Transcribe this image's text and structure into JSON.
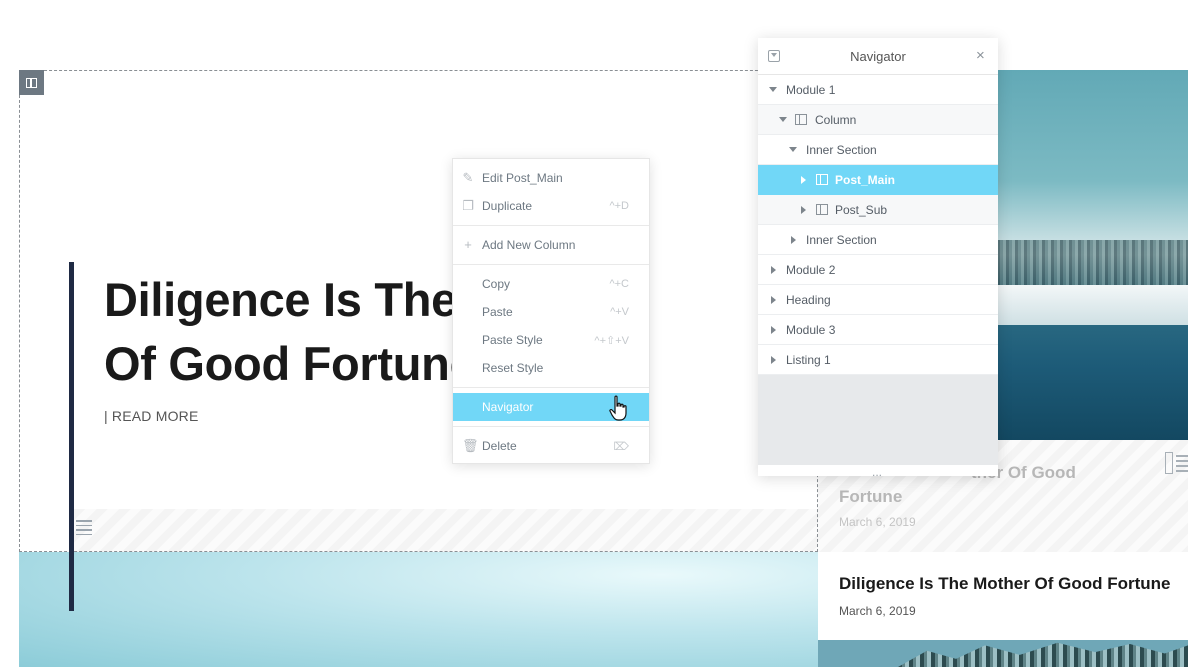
{
  "page": {
    "hero_title": "Diligence Is The\nOf Good Fortune",
    "read_more": "| READ MORE",
    "faded_post": {
      "title": "Dilige... ...ther Of Good Fortune",
      "title_line1_visible": "ther Of Good",
      "title_line2_visible": "Fortune",
      "date": "March 6, 2019"
    },
    "post_card": {
      "title": "Diligence Is The Mother Of Good Fortune",
      "date": "March 6, 2019"
    }
  },
  "context_menu": {
    "items": [
      {
        "label": "Edit Post_Main",
        "icon": "pencil-icon",
        "shortcut": ""
      },
      {
        "label": "Duplicate",
        "icon": "copy-icon",
        "shortcut": "^+D"
      },
      {
        "label": "Add New Column",
        "icon": "plus-icon",
        "shortcut": ""
      },
      {
        "label": "Copy",
        "icon": "",
        "shortcut": "^+C"
      },
      {
        "label": "Paste",
        "icon": "",
        "shortcut": "^+V"
      },
      {
        "label": "Paste Style",
        "icon": "",
        "shortcut": "^+⇧+V"
      },
      {
        "label": "Reset Style",
        "icon": "",
        "shortcut": ""
      },
      {
        "label": "Navigator",
        "icon": "",
        "shortcut": ""
      },
      {
        "label": "Delete",
        "icon": "trash-icon",
        "shortcut": "⌦"
      }
    ],
    "active_item": "Navigator"
  },
  "navigator": {
    "title": "Navigator",
    "close": "×",
    "resize_handle": "...",
    "rows": [
      {
        "label": "Module 1",
        "expanded": true,
        "has_icon": false
      },
      {
        "label": "Column",
        "expanded": true,
        "has_icon": true
      },
      {
        "label": "Inner Section",
        "expanded": true,
        "has_icon": false
      },
      {
        "label": "Post_Main",
        "expanded": false,
        "has_icon": true,
        "selected": true
      },
      {
        "label": "Post_Sub",
        "expanded": false,
        "has_icon": true
      },
      {
        "label": "Inner Section",
        "expanded": false,
        "has_icon": false
      },
      {
        "label": "Module 2",
        "expanded": false,
        "has_icon": false
      },
      {
        "label": "Heading",
        "expanded": false,
        "has_icon": false
      },
      {
        "label": "Module 3",
        "expanded": false,
        "has_icon": false
      },
      {
        "label": "Listing 1",
        "expanded": false,
        "has_icon": false
      }
    ]
  },
  "colors": {
    "accent": "#71d7f7",
    "heading": "#1a1a1a",
    "accent_bar": "#1f2a44"
  }
}
